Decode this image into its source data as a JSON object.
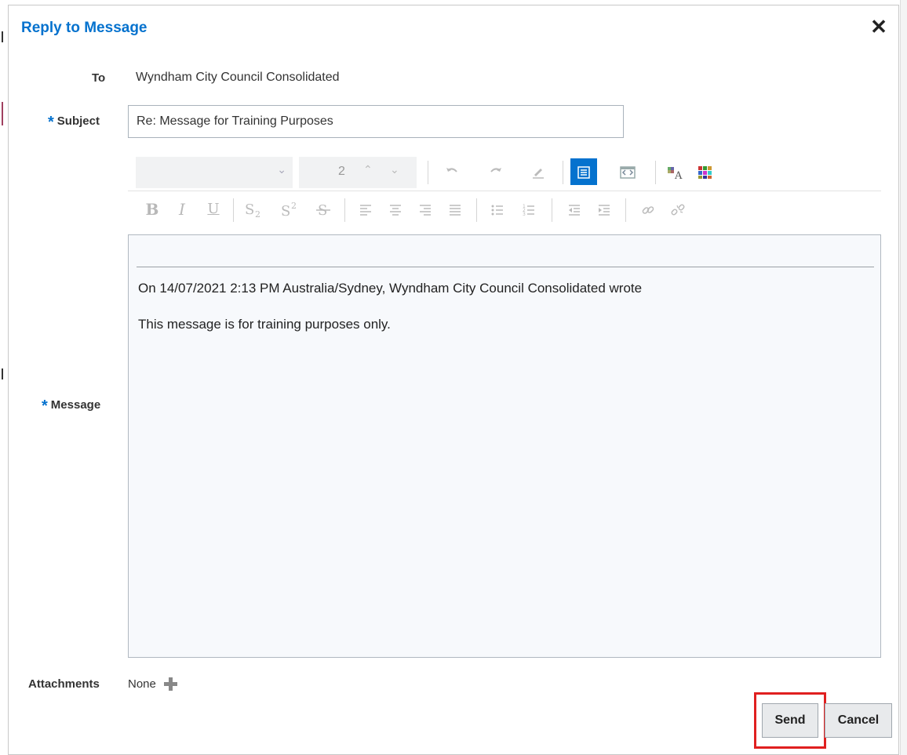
{
  "dialog": {
    "title": "Reply to Message",
    "close_glyph": "✕"
  },
  "form": {
    "to_label": "To",
    "to_value": "Wyndham City Council Consolidated",
    "subject_label": "Subject",
    "subject_value": "Re: Message for Training Purposes",
    "message_label": "Message",
    "required_marker": "*",
    "attachments_label": "Attachments",
    "attachments_value": "None"
  },
  "toolbar": {
    "font_size_value": "2",
    "row1_icons": [
      "undo-icon",
      "redo-icon",
      "clear-format-icon",
      "rich-text-mode-icon",
      "source-mode-icon",
      "text-color-icon",
      "background-color-icon"
    ],
    "row2_icons": [
      "bold-icon",
      "italic-icon",
      "underline-icon",
      "subscript-icon",
      "superscript-icon",
      "strikethrough-icon",
      "align-left-icon",
      "align-center-icon",
      "align-right-icon",
      "justify-icon",
      "bullet-list-icon",
      "numbered-list-icon",
      "outdent-icon",
      "indent-icon",
      "link-icon",
      "unlink-icon"
    ],
    "bold_glyph": "B",
    "italic_glyph": "I",
    "underline_glyph": "U"
  },
  "editor": {
    "quote_header": "On 14/07/2021 2:13 PM Australia/Sydney, Wyndham City Council Consolidated wrote",
    "quote_body": "This message is for training purposes only."
  },
  "buttons": {
    "send": "Send",
    "cancel": "Cancel"
  },
  "colors": {
    "accent": "#0572ce",
    "highlight": "#e02020"
  }
}
